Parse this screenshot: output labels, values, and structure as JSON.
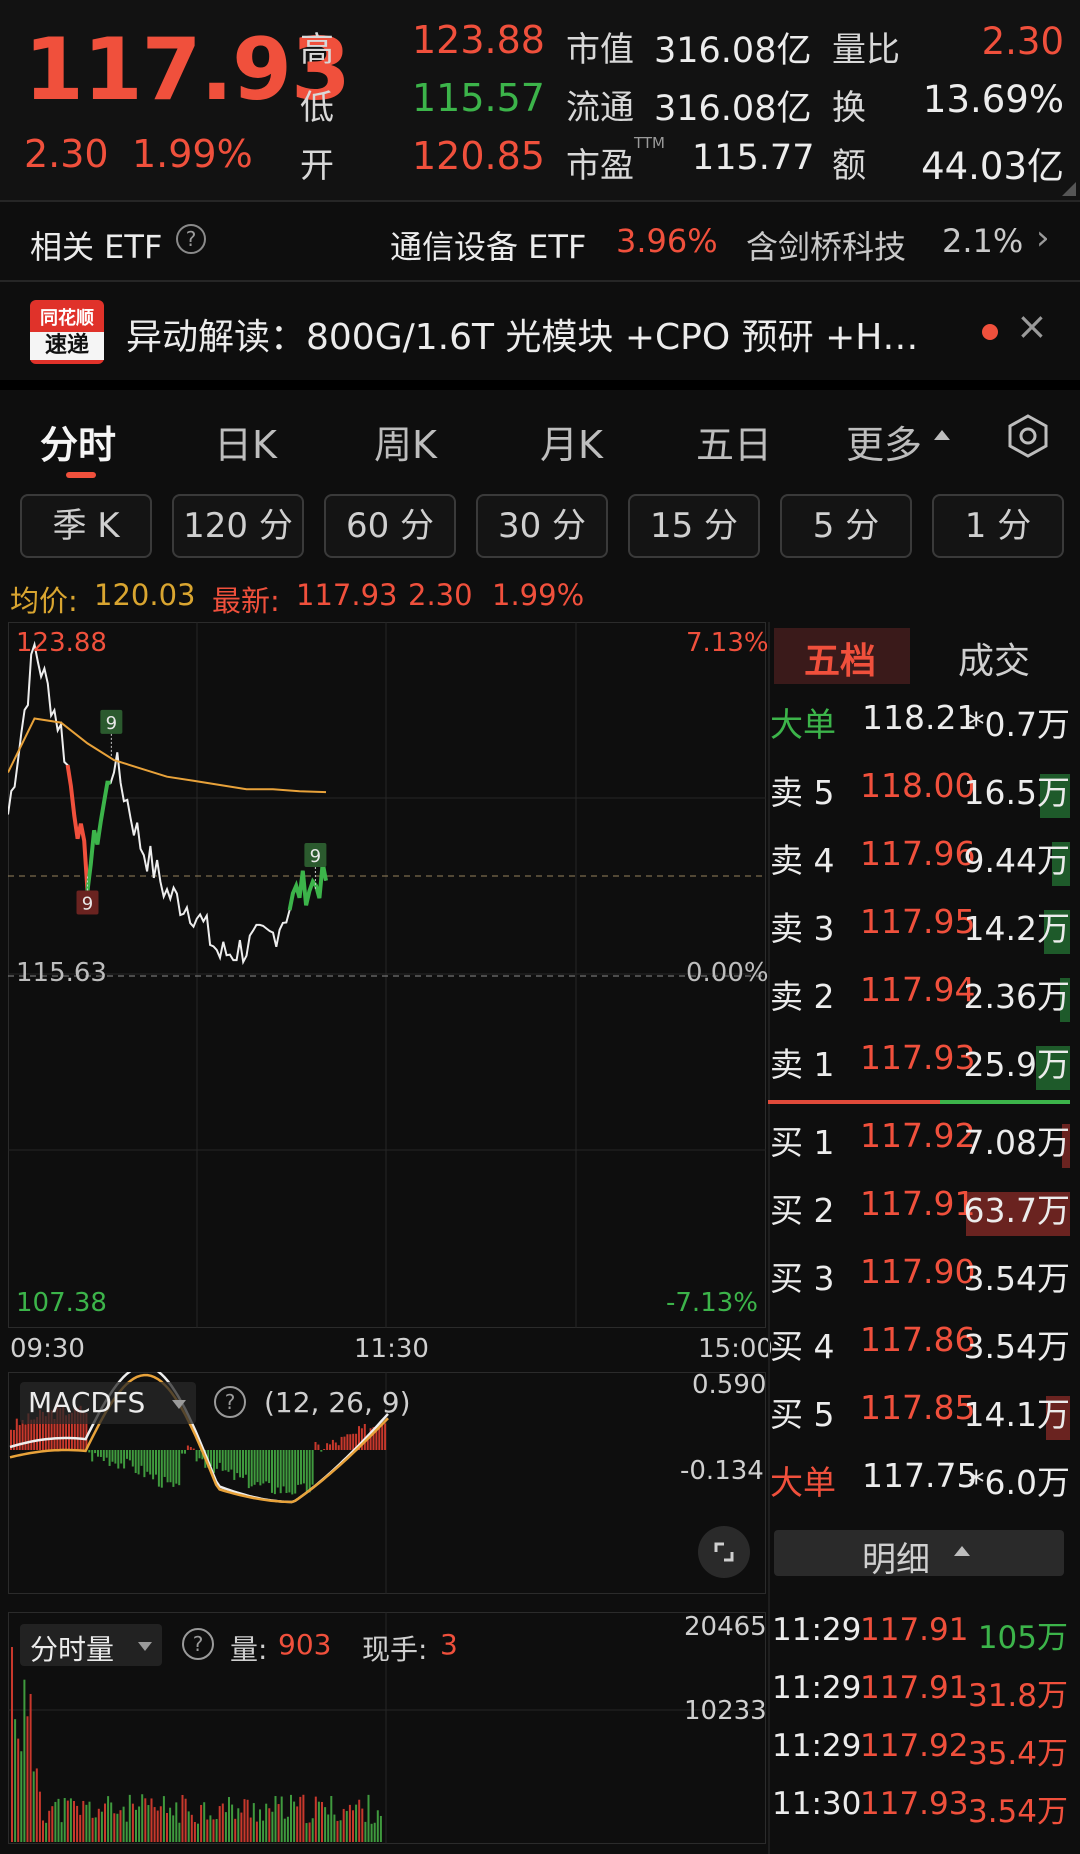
{
  "quote": {
    "price": "117.93",
    "change": "2.30",
    "change_pct": "1.99%",
    "high_label": "高",
    "high": "123.88",
    "low_label": "低",
    "low": "115.57",
    "open_label": "开",
    "open": "120.85",
    "mcap_label": "市值",
    "mcap": "316.08亿",
    "float_label": "流通",
    "float": "316.08亿",
    "pe_label": "市盈",
    "pe_sup": "TTM",
    "pe": "115.77",
    "vr_label": "量比",
    "vr": "2.30",
    "turnover_label": "换",
    "turnover": "13.69%",
    "amount_label": "额",
    "amount": "44.03亿"
  },
  "etf": {
    "label": "相关 ETF",
    "name1": "通信设备 ETF",
    "pct1": "3.96%",
    "name2": "含剑桥科技",
    "pct2": "2.1%"
  },
  "news": {
    "logo_top": "同花顺",
    "logo_bottom": "速递",
    "text": "异动解读：800G/1.6T 光模块 +CPO 预研 +H…"
  },
  "tabs": [
    "分时",
    "日K",
    "周K",
    "月K",
    "五日",
    "更多"
  ],
  "periods": [
    "季 K",
    "120 分",
    "60 分",
    "30 分",
    "15 分",
    "5 分",
    "1 分"
  ],
  "info": {
    "avg_label": "均价:",
    "avg": "120.03",
    "last_label": "最新:",
    "last": "117.93",
    "chg": "2.30",
    "pct": "1.99%"
  },
  "chart_labels": {
    "max": "123.88",
    "max_pct": "7.13%",
    "prev": "115.63",
    "prev_pct": "0.00%",
    "min": "107.38",
    "min_pct": "-7.13%",
    "t_start": "09:30",
    "t_mid": "11:30",
    "t_end": "15:00",
    "marker": "9"
  },
  "chart_data": {
    "type": "line",
    "x": [
      "09:30",
      "09:40",
      "09:50",
      "10:00",
      "10:10",
      "10:20",
      "10:30",
      "10:40",
      "10:50",
      "11:00",
      "11:10",
      "11:20",
      "11:30"
    ],
    "series": [
      {
        "values": [
          119.5,
          123.5,
          121.5,
          118.0,
          120.8,
          118.8,
          117.6,
          117.2,
          116.1,
          116.3,
          116.6,
          117.7,
          117.9
        ]
      },
      {
        "values": [
          120.5,
          121.8,
          121.7,
          121.2,
          120.8,
          120.6,
          120.4,
          120.3,
          120.2,
          120.1,
          120.1,
          120.05,
          120.03
        ]
      }
    ],
    "ylim": [
      107.38,
      123.88
    ],
    "prev_close": 115.63
  },
  "macd": {
    "name": "MACDFS",
    "help": "?",
    "params": "(12, 26, 9)",
    "top": "0.590",
    "bottom": "-0.134"
  },
  "volume": {
    "name": "分时量",
    "help": "?",
    "vol_label": "量:",
    "vol": "903",
    "hand_label": "现手:",
    "hand": "3",
    "top": "20465",
    "mid": "10233"
  },
  "book": {
    "tab_active": "五档",
    "tab_other": "成交",
    "big_sell": {
      "label": "大单",
      "price": "118.21",
      "vol": "*0.7万"
    },
    "asks": [
      {
        "label": "卖 5",
        "price": "118.00",
        "vol": "16.5万"
      },
      {
        "label": "卖 4",
        "price": "117.96",
        "vol": "9.44万"
      },
      {
        "label": "卖 3",
        "price": "117.95",
        "vol": "14.2万"
      },
      {
        "label": "卖 2",
        "price": "117.94",
        "vol": "2.36万"
      },
      {
        "label": "卖 1",
        "price": "117.93",
        "vol": "25.9万"
      }
    ],
    "bids": [
      {
        "label": "买 1",
        "price": "117.92",
        "vol": "7.08万"
      },
      {
        "label": "买 2",
        "price": "117.91",
        "vol": "63.7万"
      },
      {
        "label": "买 3",
        "price": "117.90",
        "vol": "3.54万"
      },
      {
        "label": "买 4",
        "price": "117.86",
        "vol": "3.54万"
      },
      {
        "label": "买 5",
        "price": "117.85",
        "vol": "14.1万"
      }
    ],
    "big_buy": {
      "label": "大单",
      "price": "117.75",
      "vol": "*6.0万"
    },
    "detail_label": "明细"
  },
  "ticks": [
    {
      "time": "11:29",
      "price": "117.91",
      "vol": "105万",
      "dir": "green"
    },
    {
      "time": "11:29",
      "price": "117.91",
      "vol": "31.8万",
      "dir": "red"
    },
    {
      "time": "11:29",
      "price": "117.92",
      "vol": "35.4万",
      "dir": "red"
    },
    {
      "time": "11:30",
      "price": "117.93",
      "vol": "3.54万",
      "dir": "red"
    }
  ],
  "colors": {
    "up": "#f0503c",
    "down": "#3cb44a",
    "avg_line": "#e8a23a",
    "price_line": "#eeeeee"
  }
}
